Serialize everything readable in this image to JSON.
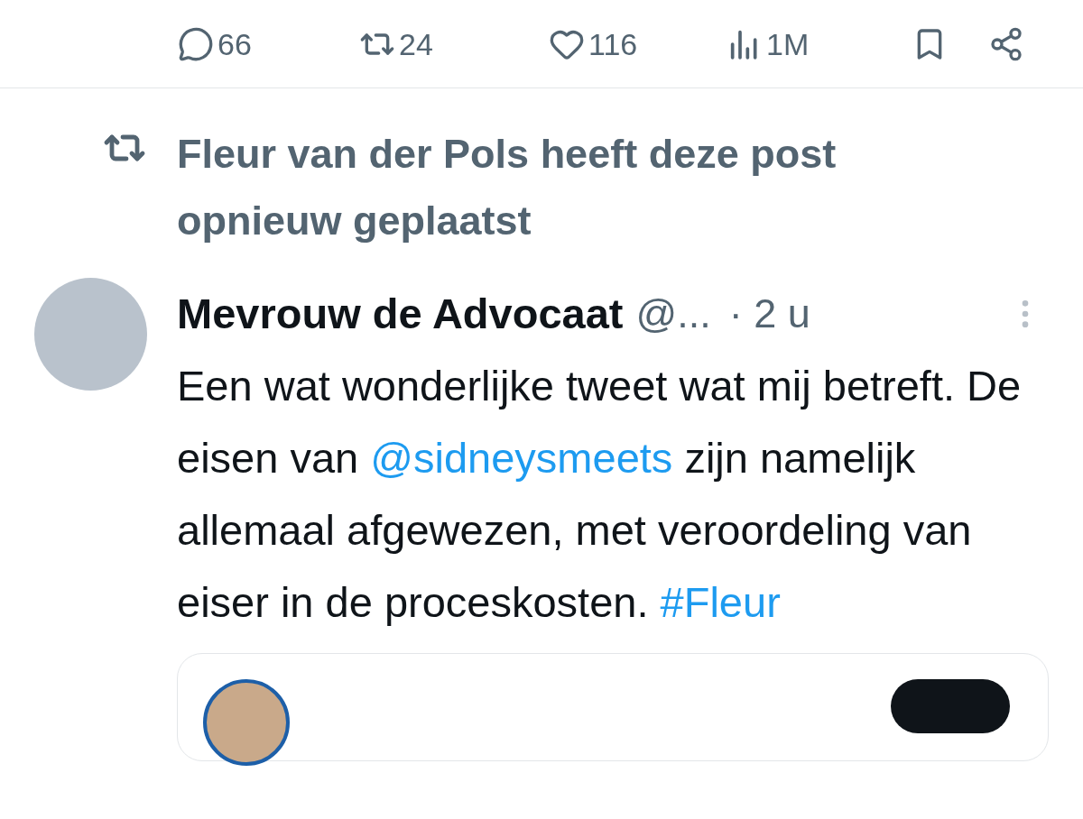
{
  "actions": [
    {
      "kind": "reply",
      "count": "66"
    },
    {
      "kind": "repost",
      "count": "24"
    },
    {
      "kind": "like",
      "count": "116"
    },
    {
      "kind": "views",
      "count": "1M"
    },
    {
      "kind": "bookmark"
    },
    {
      "kind": "share"
    }
  ],
  "repost_notice": {
    "text": "Fleur van der Pols heeft deze post opnieuw geplaatst"
  },
  "post": {
    "author": "Mevrouw de Advocaat",
    "handle": "@...",
    "time": "· 2 u",
    "body": [
      {
        "kind": "text",
        "text": "Een wat wonderlijke tweet wat mij betreft. De eisen van "
      },
      {
        "kind": "mention",
        "text": "@sidneysmeets"
      },
      {
        "kind": "text",
        "text": " zijn namelijk allemaal afgewezen, met veroordeling van eiser in de proceskosten. "
      },
      {
        "kind": "hashtag",
        "text": "#Fleur"
      }
    ]
  }
}
